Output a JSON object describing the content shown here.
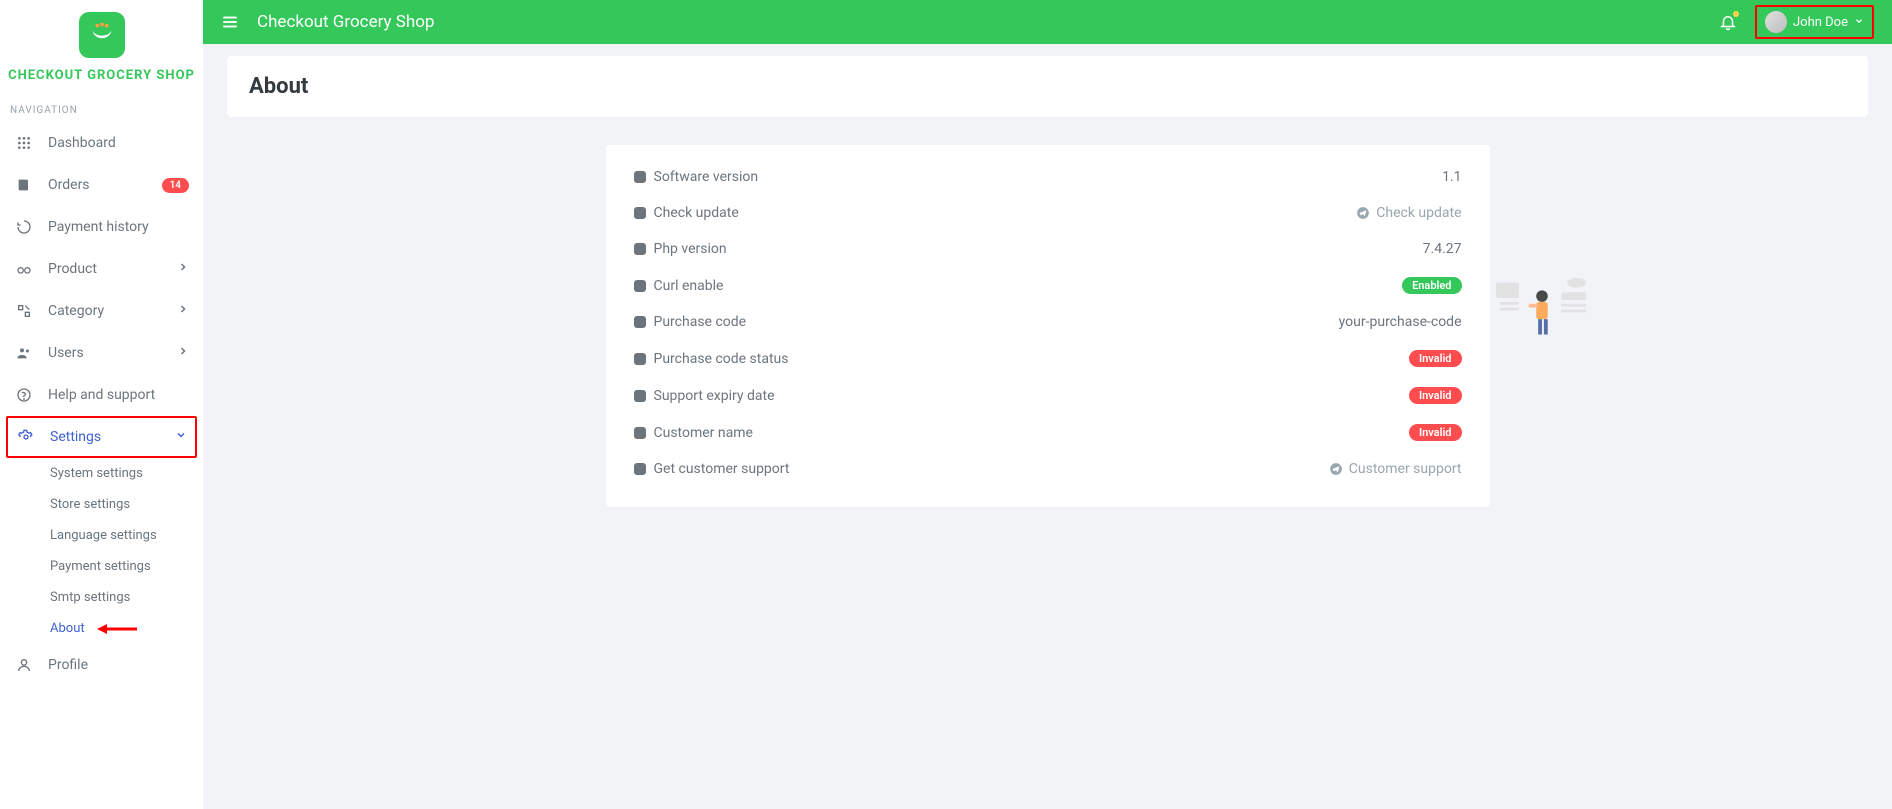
{
  "brand": {
    "title": "CHECKOUT GROCERY SHOP"
  },
  "nav": {
    "section_label": "NAVIGATION",
    "items": {
      "dashboard": "Dashboard",
      "orders": "Orders",
      "orders_badge": "14",
      "payment_history": "Payment history",
      "product": "Product",
      "category": "Category",
      "users": "Users",
      "help": "Help and support",
      "settings": "Settings",
      "profile": "Profile"
    },
    "settings_sub": {
      "system": "System settings",
      "store": "Store settings",
      "language": "Language settings",
      "payment": "Payment settings",
      "smtp": "Smtp settings",
      "about": "About"
    }
  },
  "topbar": {
    "app_title": "Checkout Grocery Shop",
    "user_name": "John Doe"
  },
  "page": {
    "title": "About"
  },
  "about": {
    "rows": {
      "software_version": {
        "label": "Software version",
        "value": "1.1"
      },
      "check_update": {
        "label": "Check update",
        "value": "Check update"
      },
      "php_version": {
        "label": "Php version",
        "value": "7.4.27"
      },
      "curl_enable": {
        "label": "Curl enable",
        "value": "Enabled"
      },
      "purchase_code": {
        "label": "Purchase code",
        "value": "your-purchase-code"
      },
      "pcode_status": {
        "label": "Purchase code status",
        "value": "Invalid"
      },
      "support_expiry": {
        "label": "Support expiry date",
        "value": "Invalid"
      },
      "customer_name": {
        "label": "Customer name",
        "value": "Invalid"
      },
      "get_support": {
        "label": "Get customer support",
        "value": "Customer support"
      }
    }
  }
}
